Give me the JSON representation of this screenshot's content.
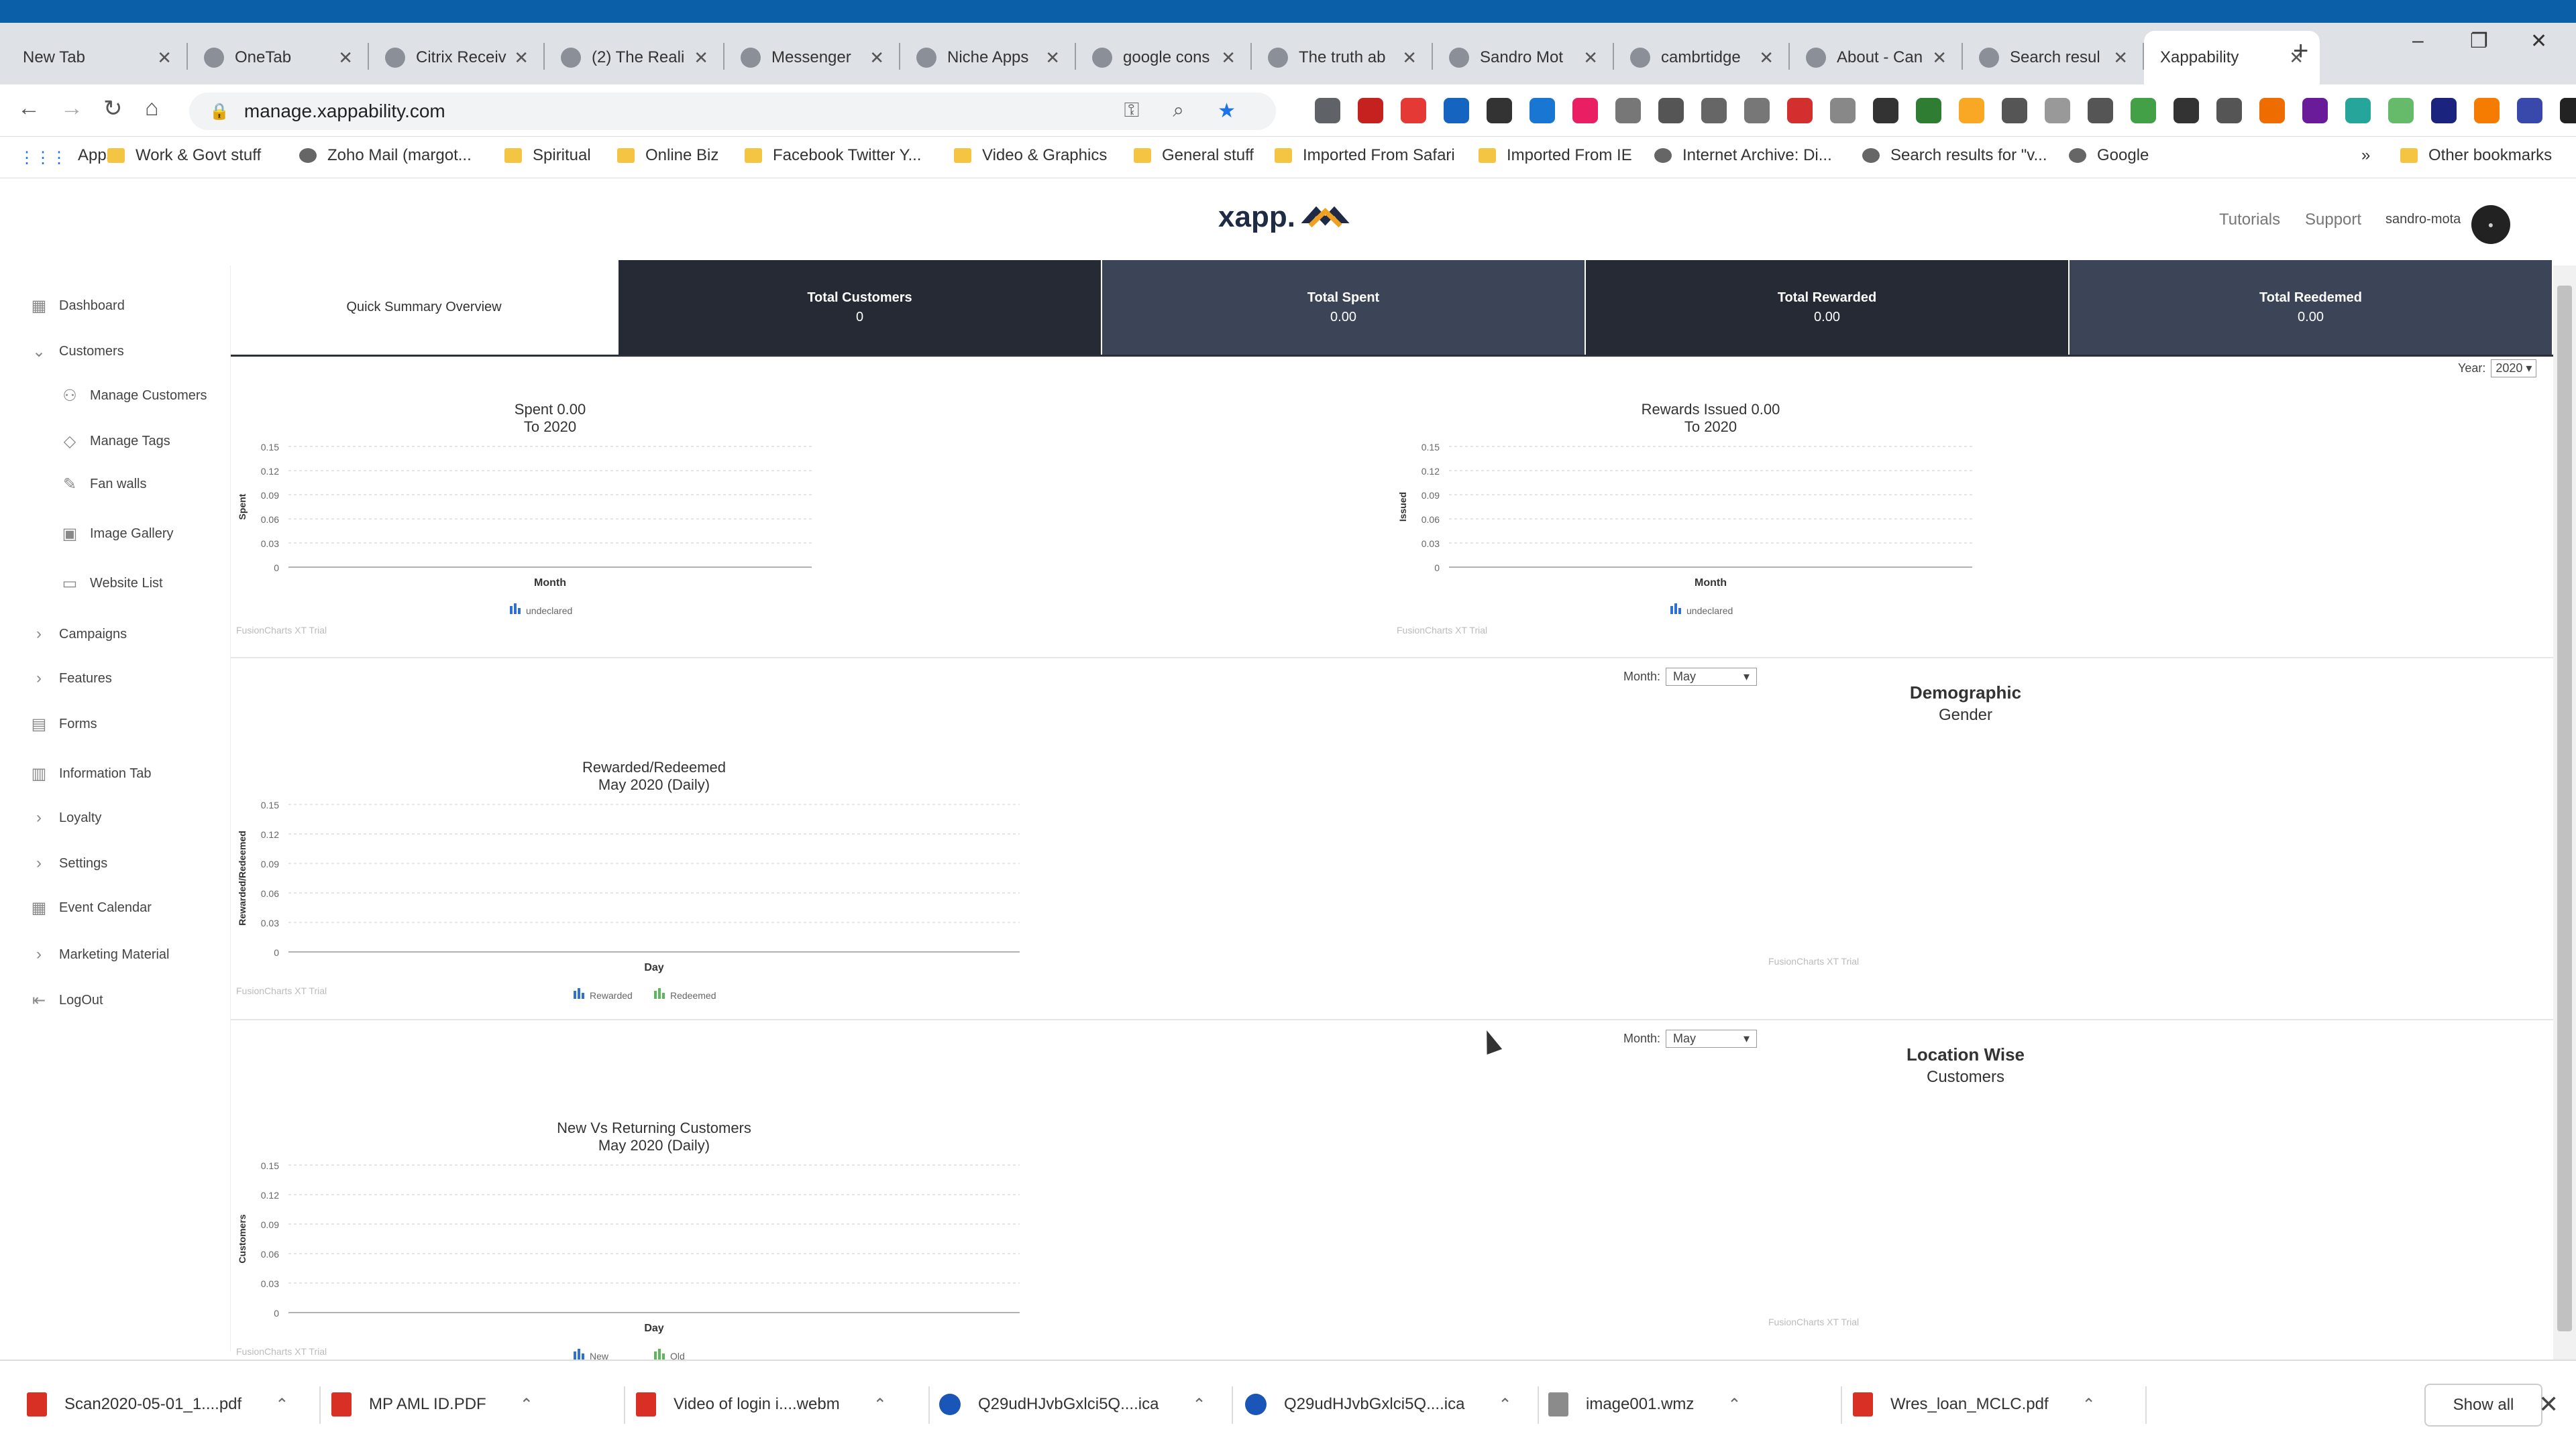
{
  "browser": {
    "tabs": [
      {
        "label": "New Tab",
        "icon": "blank-icon"
      },
      {
        "label": "OneTab",
        "icon": "onetab-icon"
      },
      {
        "label": "Citrix Receiv",
        "icon": "citrix-icon"
      },
      {
        "label": "(2) The Reali",
        "icon": "facebook-icon"
      },
      {
        "label": "Messenger",
        "icon": "messenger-icon"
      },
      {
        "label": "Niche Apps",
        "icon": "niche-icon"
      },
      {
        "label": "google cons",
        "icon": "google-icon"
      },
      {
        "label": "The truth ab",
        "icon": "s-icon"
      },
      {
        "label": "Sandro Mot",
        "icon": "github-icon"
      },
      {
        "label": "cambrtidge",
        "icon": "google-icon"
      },
      {
        "label": "About - Can",
        "icon": "about-icon"
      },
      {
        "label": "Search resul",
        "icon": "gmail-icon"
      },
      {
        "label": "Xappability",
        "icon": "blank-icon",
        "active": true
      }
    ],
    "url": "manage.xappability.com",
    "bookmarks": [
      {
        "label": "Apps",
        "type": "apps"
      },
      {
        "label": "Work & Govt stuff",
        "type": "folder"
      },
      {
        "label": "Zoho Mail (margot...",
        "type": "site"
      },
      {
        "label": "Spiritual",
        "type": "folder"
      },
      {
        "label": "Online Biz",
        "type": "folder"
      },
      {
        "label": "Facebook Twitter Y...",
        "type": "folder"
      },
      {
        "label": "Video & Graphics",
        "type": "folder"
      },
      {
        "label": "General stuff",
        "type": "folder"
      },
      {
        "label": "Imported From Safari",
        "type": "folder"
      },
      {
        "label": "Imported From IE",
        "type": "folder"
      },
      {
        "label": "Internet Archive: Di...",
        "type": "site"
      },
      {
        "label": "Search results for \"v...",
        "type": "site"
      },
      {
        "label": "Google",
        "type": "site"
      }
    ],
    "bookmarks_more": "»",
    "other_bookmarks": "Other bookmarks"
  },
  "header": {
    "logo_text": "xapp.",
    "tutorials": "Tutorials",
    "support": "Support",
    "username": "sandro-mota"
  },
  "sidebar": {
    "items": [
      {
        "label": "Dashboard",
        "icon": "dashboard-icon"
      },
      {
        "label": "Customers",
        "icon": "chevron-down-icon"
      },
      {
        "label": "Manage Customers",
        "icon": "user-icon"
      },
      {
        "label": "Manage Tags",
        "icon": "tag-icon"
      },
      {
        "label": "Fan walls",
        "icon": "edit-icon"
      },
      {
        "label": "Image Gallery",
        "icon": "image-icon"
      },
      {
        "label": "Website List",
        "icon": "monitor-icon"
      },
      {
        "label": "Campaigns",
        "icon": "chevron-right-icon"
      },
      {
        "label": "Features",
        "icon": "chevron-right-icon"
      },
      {
        "label": "Forms",
        "icon": "forms-icon"
      },
      {
        "label": "Information Tab",
        "icon": "info-tab-icon"
      },
      {
        "label": "Loyalty",
        "icon": "chevron-right-icon"
      },
      {
        "label": "Settings",
        "icon": "chevron-right-icon"
      },
      {
        "label": "Event Calendar",
        "icon": "calendar-icon"
      },
      {
        "label": "Marketing Material",
        "icon": "chevron-right-icon"
      },
      {
        "label": "LogOut",
        "icon": "logout-icon"
      }
    ]
  },
  "summary": {
    "overview_label": "Quick Summary Overview",
    "cells": [
      {
        "label": "Total Customers",
        "value": "0"
      },
      {
        "label": "Total Spent",
        "value": "0.00"
      },
      {
        "label": "Total Rewarded",
        "value": "0.00"
      },
      {
        "label": "Total Reedemed",
        "value": "0.00"
      }
    ]
  },
  "filters": {
    "year_label": "Year:",
    "year_value": "2020",
    "month_label": "Month:",
    "month_value": "May"
  },
  "panels": {
    "demographic_title": "Demographic",
    "demographic_sub": "Gender",
    "location_title": "Location Wise",
    "location_sub": "Customers",
    "trial_text": "FusionCharts XT Trial"
  },
  "chart_data": [
    {
      "type": "bar",
      "title": "Spent 0.00",
      "subtitle": "To 2020",
      "xlabel": "Month",
      "ylabel": "Spent",
      "yticks": [
        "0.15",
        "0.12",
        "0.09",
        "0.06",
        "0.03",
        "0"
      ],
      "ylim": [
        0,
        0.15
      ],
      "series": [
        {
          "name": "undeclared",
          "values": []
        }
      ]
    },
    {
      "type": "bar",
      "title": "Rewards Issued 0.00",
      "subtitle": "To 2020",
      "xlabel": "Month",
      "ylabel": "Issued",
      "yticks": [
        "0.15",
        "0.12",
        "0.09",
        "0.06",
        "0.03",
        "0"
      ],
      "ylim": [
        0,
        0.15
      ],
      "series": [
        {
          "name": "undeclared",
          "values": []
        }
      ]
    },
    {
      "type": "bar",
      "title": "Rewarded/Redeemed",
      "subtitle": "May 2020 (Daily)",
      "xlabel": "Day",
      "ylabel": "Rewarded/Redeemed",
      "yticks": [
        "0.15",
        "0.12",
        "0.09",
        "0.06",
        "0.03",
        "0"
      ],
      "ylim": [
        0,
        0.15
      ],
      "series": [
        {
          "name": "Rewarded",
          "values": []
        },
        {
          "name": "Redeemed",
          "values": []
        }
      ]
    },
    {
      "type": "bar",
      "title": "New Vs Returning Customers",
      "subtitle": "May 2020 (Daily)",
      "xlabel": "Day",
      "ylabel": "Customers",
      "yticks": [
        "0.15",
        "0.12",
        "0.09",
        "0.06",
        "0.03",
        "0"
      ],
      "ylim": [
        0,
        0.15
      ],
      "series": [
        {
          "name": "New",
          "values": []
        },
        {
          "name": "Old",
          "values": []
        }
      ]
    }
  ],
  "downloads": [
    {
      "label": "Scan2020-05-01_1....pdf",
      "type": "pdf"
    },
    {
      "label": "MP AML ID.PDF",
      "type": "pdf"
    },
    {
      "label": "Video of  login i....webm",
      "type": "pdf"
    },
    {
      "label": "Q29udHJvbGxlci5Q....ica",
      "type": "ica"
    },
    {
      "label": "Q29udHJvbGxlci5Q....ica",
      "type": "ica"
    },
    {
      "label": "image001.wmz",
      "type": "img"
    },
    {
      "label": "Wres_loan_MCLC.pdf",
      "type": "pdf"
    }
  ],
  "show_all": "Show all",
  "colors": {
    "summary_dark": "#252a35",
    "summary_mid": "#3c4457",
    "accent_orange": "#f0a020",
    "legend_blue": "#2f6fd6",
    "legend_green": "#5cb85c"
  }
}
